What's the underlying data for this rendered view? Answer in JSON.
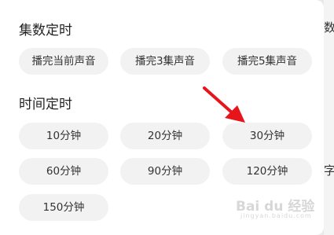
{
  "episode_timer": {
    "title": "集数定时",
    "options": [
      {
        "label": "播完当前声音"
      },
      {
        "label": "播完3集声音"
      },
      {
        "label": "播完5集声音"
      }
    ]
  },
  "time_timer": {
    "title": "时间定时",
    "options": [
      {
        "label": "10分钟"
      },
      {
        "label": "20分钟"
      },
      {
        "label": "30分钟"
      },
      {
        "label": "60分钟"
      },
      {
        "label": "90分钟"
      },
      {
        "label": "120分钟"
      },
      {
        "label": "150分钟"
      }
    ]
  },
  "annotation_arrow": {
    "color": "#e8141c"
  },
  "watermark": {
    "text": "Bai du 经验",
    "subtext": "jingyan.baidu.com"
  },
  "right_edge": {
    "glyphs": [
      "数",
      "字"
    ]
  }
}
